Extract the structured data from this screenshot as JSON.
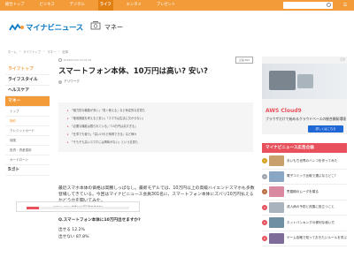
{
  "topnav": {
    "items": [
      "総合トップ",
      "ビジネス",
      "デジタル",
      "ライフ",
      "エンタメ",
      "プレゼント"
    ],
    "active_index": 3
  },
  "header": {
    "logo_text": "マイナビニュース",
    "section_title": "マネー"
  },
  "breadcrumb": [
    "ホーム",
    "ライフトップ",
    "マネー",
    "記事"
  ],
  "left_nav": {
    "items": [
      {
        "label": "ライフトップ",
        "type": "head-orange"
      },
      {
        "label": "ライフスタイル",
        "type": "head"
      },
      {
        "label": "ヘルスケア",
        "type": "head"
      },
      {
        "label": "マネー",
        "type": "head-active"
      },
      {
        "label": "トップ",
        "type": "sub"
      },
      {
        "label": "節約",
        "type": "sub-hl"
      },
      {
        "label": "クレジットカード",
        "type": "sub"
      },
      {
        "label": "保険",
        "type": "sub"
      },
      {
        "label": "投資・資産運用",
        "type": "sub"
      },
      {
        "label": "カードローン",
        "type": "sub"
      },
      {
        "label": "5ゴト",
        "type": "head"
      }
    ]
  },
  "article": {
    "timestamp": "2018/01/03 14:07:00",
    "badge": "記事 999",
    "title": "スマートフォン本体、10万円は高い? 安い?",
    "author": "アリワーク",
    "toc": [
      "「魅力的な機能が多い」「長く使える」など肯定的な意見も",
      "「使用頻度を考えると安い」「スマホは生活に欠かせない」",
      "「必要な機能は限られている」「10万円は高すぎる」",
      "「仕事でも使う」「高いけれど納得できる」など様々",
      "「そもそも高いスマホには興味がない」という意見も"
    ],
    "body": "最近スマホ本体の価格は高騰しっぱなし。最新モデルでは、10万円以上の高級ハイエンドスマホも多数登場してきている。今回はマイナビニュース会員301名に、スマートフォン本体にズバリ10万円払えるかどうかを聞いてみた。",
    "question": "Q.スマートフォン本体に10万円出せますか?",
    "answers": [
      {
        "label": "出せる",
        "value": "12.2%"
      },
      {
        "label": "出せない",
        "value": "87.8%"
      }
    ],
    "result_caption": "スマートフォン本体に10万円出せますか?",
    "result_fraction": 0.122
  },
  "ad": {
    "label": "広告",
    "title": "AWS Cloud9",
    "description": "ブラウザだけで始めるクラウドベースの統合開発環境",
    "button": "詳しくはこちら"
  },
  "ranking": {
    "heading": "マイナビニュース広告企画",
    "items": [
      {
        "num": "1",
        "text": "あいもち世界のハンコを作ってみた",
        "thumb": "#c9a06b"
      },
      {
        "num": "2",
        "text": "電子コミック比較で選ぶならどこ?",
        "thumb": "#8aa6c4"
      },
      {
        "num": "3",
        "text": "思春期のムーダを寝る",
        "thumb": "#d98aa0"
      },
      {
        "num": "4",
        "text": "成人病の予防と改善に役立つこと",
        "thumb": "#a8b3bd"
      },
      {
        "num": "5",
        "text": "ネットバンキングの便利な使い方",
        "thumb": "#6f8fa3"
      },
      {
        "num": "6",
        "text": "ゲーム攻略で知っておきたいルールを学ぶ",
        "thumb": "#7e6b9a"
      }
    ]
  }
}
